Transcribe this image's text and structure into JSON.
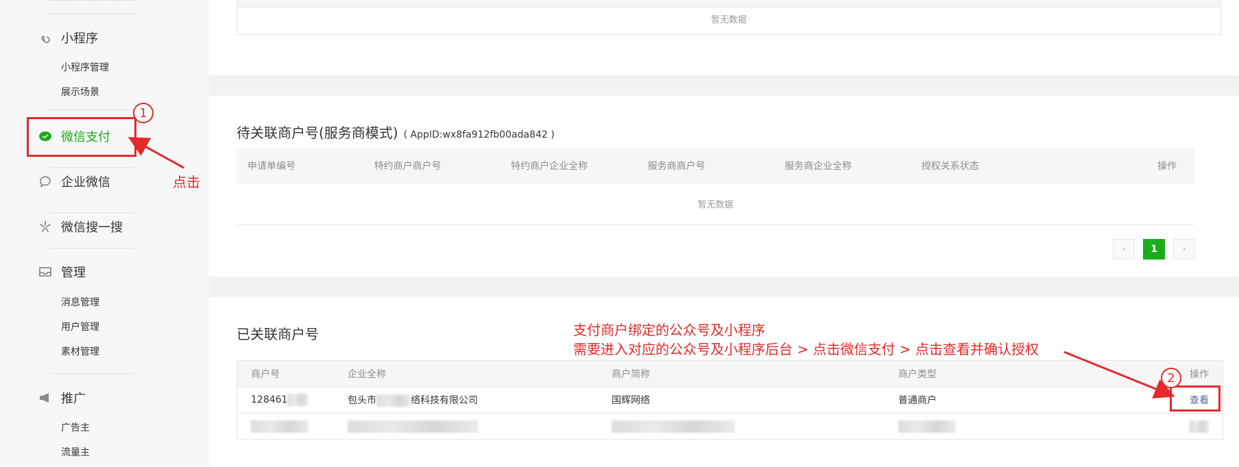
{
  "sidebar": {
    "groups": [
      {
        "label": "小程序",
        "icon": "link-icon",
        "items": [
          "小程序管理",
          "展示场景"
        ]
      },
      {
        "label": "微信支付",
        "icon": "wechat-pay-icon"
      },
      {
        "label": "企业微信",
        "icon": "chat-bubble-icon"
      },
      {
        "label": "微信搜一搜",
        "icon": "search-spark-icon"
      },
      {
        "label": "管理",
        "icon": "inbox-icon",
        "items": [
          "消息管理",
          "用户管理",
          "素材管理"
        ]
      },
      {
        "label": "推广",
        "icon": "megaphone-icon",
        "items": [
          "广告主",
          "流量主"
        ]
      }
    ],
    "active_color": "#1aad19"
  },
  "top_panel": {
    "empty_text": "暂无数据"
  },
  "pending_panel": {
    "title": "待关联商户号(服务商模式)",
    "appid": "( AppID:wx8fa912fb00ada842 )",
    "columns": [
      "申请单编号",
      "特约商户商户号",
      "特约商户企业全称",
      "服务商商户号",
      "服务商企业全称",
      "授权关系状态",
      "操作"
    ],
    "empty_text": "暂无数据",
    "pager": {
      "prev": "‹",
      "current": "1",
      "next": "›"
    }
  },
  "linked_panel": {
    "title": "已关联商户号",
    "columns": [
      "商户号",
      "企业全称",
      "商户简称",
      "商户类型",
      "操作"
    ],
    "rows": [
      {
        "merchant_id": "128461",
        "company_prefix": "包头市",
        "company_suffix": "络科技有限公司",
        "short_name": "国辉网络",
        "type": "普通商户",
        "action": "查看"
      }
    ]
  },
  "annotations": {
    "step1": "1",
    "step2": "2",
    "click_label": "点击",
    "note_line1": "支付商户绑定的公众号及小程序",
    "note_line2": "需要进入对应的公众号及小程序后台 > 点击微信支付 > 点击查看并确认授权",
    "color": "#e42a2a"
  }
}
